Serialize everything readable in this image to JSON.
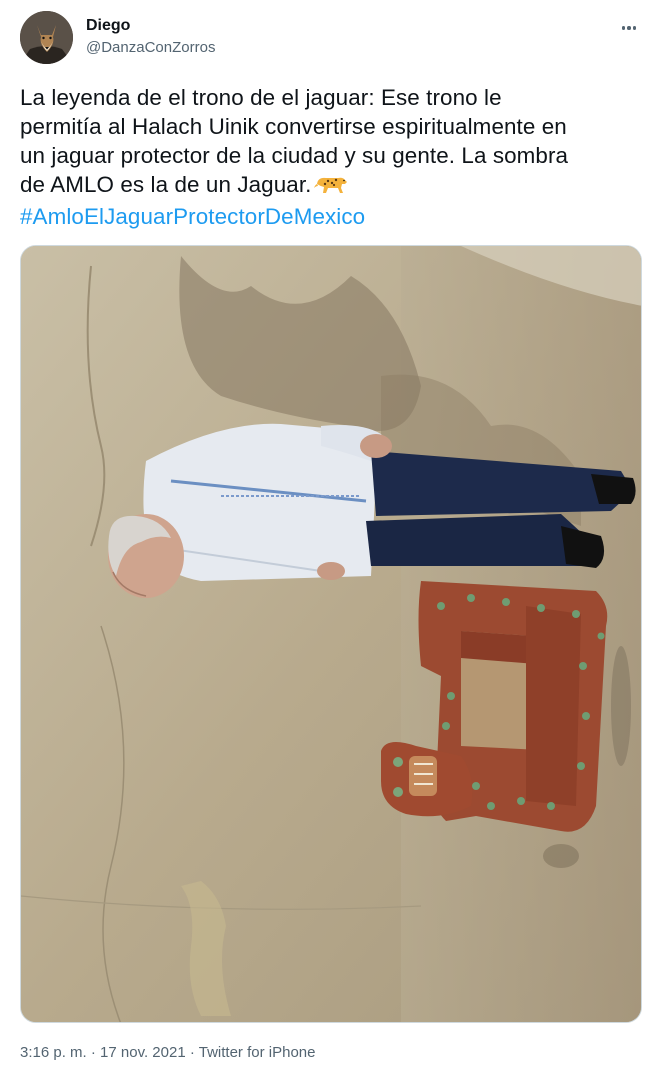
{
  "user": {
    "display_name": "Diego",
    "handle": "@DanzaConZorros"
  },
  "tweet": {
    "lines": [
      "La leyenda de el trono de el jaguar: Ese trono le",
      "permitía al Halach Uinik convertirse espiritualmente en",
      "un jaguar protector de la ciudad y su gente. La sombra",
      "de AMLO es la de un Jaguar."
    ],
    "emoji": "leopard-emoji",
    "hashtag": "#AmloElJaguarProtectorDeMexico"
  },
  "meta": {
    "time": "3:16 p. m.",
    "separator1": " · ",
    "date": "17 nov. 2021",
    "separator2": " · ",
    "source": "Twitter for iPhone"
  },
  "icons": {
    "more": "more-dots-icon"
  },
  "colors": {
    "link": "#1d9bf0",
    "secondary_text": "#536471"
  }
}
